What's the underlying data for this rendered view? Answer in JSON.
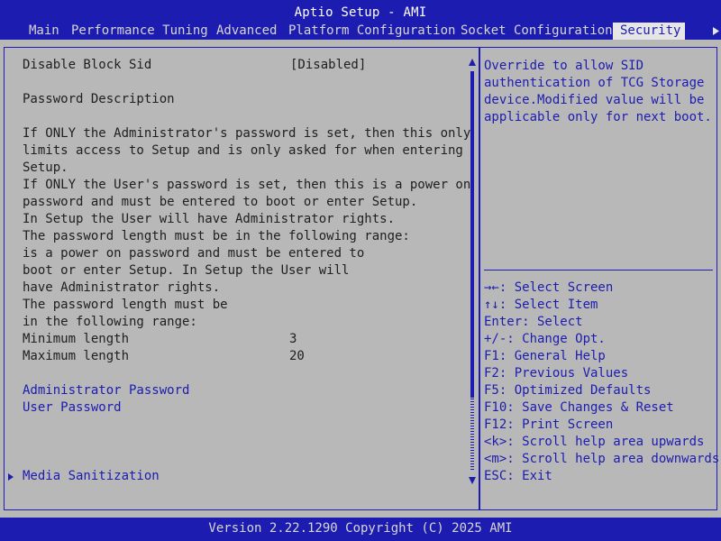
{
  "header": {
    "title": "Aptio Setup - AMI",
    "tabs": [
      {
        "label": "Main"
      },
      {
        "label": "Performance Tuning"
      },
      {
        "label": "Advanced"
      },
      {
        "label": "Platform Configuration"
      },
      {
        "label": "Socket Configuration"
      },
      {
        "label": "Security"
      }
    ],
    "active_tab": "Security"
  },
  "left": {
    "disable_block_sid": {
      "label": "Disable Block Sid",
      "value": "[Disabled]"
    },
    "password_description_title": "Password Description",
    "description_lines": [
      "If ONLY the Administrator's password is set, then this only",
      "limits access to Setup and is only asked for when entering",
      "Setup.",
      "If ONLY the User's password is set, then this is a power on",
      "password and must be entered to boot or enter Setup.",
      "In Setup the User will have Administrator rights.",
      "The password length must be in the following range:",
      "is a power on password and must be entered to",
      "boot or enter Setup. In Setup the User will",
      "have Administrator rights.",
      "The password length must be",
      "in the following range:"
    ],
    "minimum_length": {
      "label": "Minimum length",
      "value": "3"
    },
    "maximum_length": {
      "label": "Maximum length",
      "value": "20"
    },
    "administrator_password": "Administrator Password",
    "user_password": "User Password",
    "media_sanitization": "Media Sanitization"
  },
  "help": {
    "text": "Override to allow SID\nauthentication of TCG Storage\ndevice.Modified value will be\napplicable only for next boot."
  },
  "keys": [
    "→←: Select Screen",
    "↑↓: Select Item",
    "Enter: Select",
    "+/-: Change Opt.",
    "F1: General Help",
    "F2: Previous Values",
    "F5: Optimized Defaults",
    "F10: Save Changes & Reset",
    "F12: Print Screen",
    "<k>: Scroll help area upwards",
    "<m>: Scroll help area downwards",
    "ESC: Exit"
  ],
  "footer": {
    "text": "Version 2.22.1290 Copyright (C) 2025 AMI"
  },
  "colors": {
    "accent_blue": "#1c1cb0",
    "background_gray": "#b8b8b8",
    "active_tab_bg": "#e6e6e6"
  }
}
